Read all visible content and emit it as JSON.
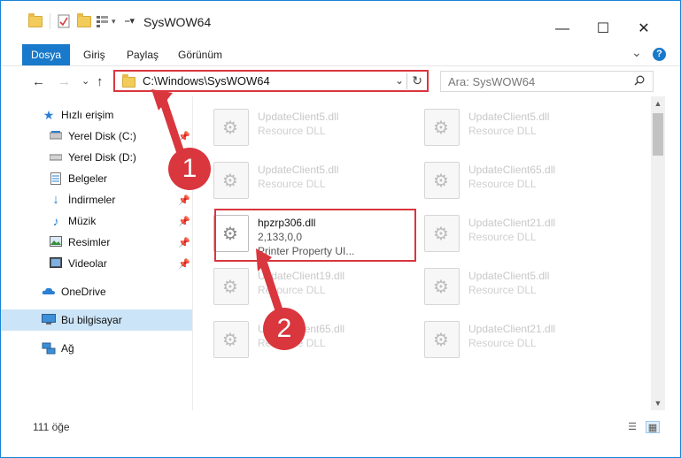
{
  "window": {
    "title": "SysWOW64",
    "minimize": "—",
    "maximize": "☐",
    "close": "✕"
  },
  "ribbon": {
    "tabs": [
      "Dosya",
      "Giriş",
      "Paylaş",
      "Görünüm"
    ],
    "expand": "⌄",
    "help": "?"
  },
  "nav": {
    "back": "←",
    "forward": "→",
    "recent": "⌄",
    "up": "↑",
    "address": "C:\\Windows\\SysWOW64",
    "address_dropdown": "⌄",
    "refresh": "↻",
    "search_placeholder": "Ara: SysWOW64",
    "search_icon": "⌕"
  },
  "sidebar": {
    "items": [
      {
        "label": "Hızlı erişim",
        "icon": "star-icon"
      },
      {
        "label": "Yerel Disk (C:)",
        "icon": "drive-icon"
      },
      {
        "label": "Yerel Disk (D:)",
        "icon": "drive-icon"
      },
      {
        "label": "Belgeler",
        "icon": "document-icon"
      },
      {
        "label": "İndirmeler",
        "icon": "download-icon"
      },
      {
        "label": "Müzik",
        "icon": "music-icon"
      },
      {
        "label": "Resimler",
        "icon": "picture-icon"
      },
      {
        "label": "Videolar",
        "icon": "video-icon"
      },
      {
        "label": "OneDrive",
        "icon": "cloud-icon"
      },
      {
        "label": "Bu bilgisayar",
        "icon": "computer-icon"
      },
      {
        "label": "Ağ",
        "icon": "network-icon"
      }
    ]
  },
  "files": [
    {
      "name": "UpdateClient5.dll",
      "desc": "Resource DLL"
    },
    {
      "name": "UpdateClient5.dll",
      "desc": "Resource DLL"
    },
    {
      "name": "UpdateClient5.dll",
      "desc": "Resource DLL"
    },
    {
      "name": "UpdateClient65.dll",
      "desc": "Resource DLL"
    },
    {
      "name": "hpzrp306.dll",
      "desc": "2,133,0,0",
      "desc2": "Printer Property UI..."
    },
    {
      "name": "UpdateClient21.dll",
      "desc": "Resource DLL"
    },
    {
      "name": "UpdateClient19.dll",
      "desc": "Resource DLL"
    },
    {
      "name": "UpdateClient5.dll",
      "desc": "Resource DLL"
    },
    {
      "name": "UpdateClient65.dll",
      "desc": "Resource DLL"
    },
    {
      "name": "UpdateClient21.dll",
      "desc": "Resource DLL"
    }
  ],
  "status": {
    "count": "111 öğe"
  },
  "annotations": {
    "step1": "1",
    "step2": "2",
    "color": "#d9363e"
  },
  "colors": {
    "accent": "#1979ca",
    "selection": "#cce4f7",
    "highlight": "#d9363e"
  }
}
